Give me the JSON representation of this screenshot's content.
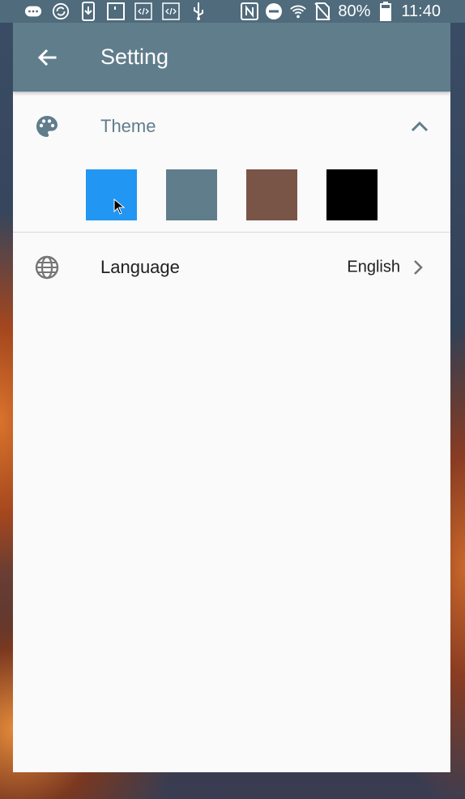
{
  "status_bar": {
    "icons_left": [
      "chat-bubble-icon",
      "sync-circle-icon",
      "download-icon",
      "sim-icon",
      "code-icon",
      "code-icon",
      "usb-icon"
    ],
    "icons_right": [
      "nfc-icon",
      "do-not-disturb-icon",
      "wifi-icon",
      "no-sim-icon",
      "battery-icon"
    ],
    "battery": "80%",
    "time": "11:40"
  },
  "app_bar": {
    "title": "Setting",
    "back_icon": "arrow-back-icon"
  },
  "theme": {
    "label": "Theme",
    "icon": "palette-icon",
    "expanded": true,
    "swatches": [
      "#2196f3",
      "#607d8b",
      "#795548",
      "#000000"
    ]
  },
  "language": {
    "label": "Language",
    "value": "English",
    "icon": "globe-icon"
  },
  "colors": {
    "primary": "#607d8b",
    "status_bar": "#4f6b7c",
    "background": "#fafafa"
  }
}
